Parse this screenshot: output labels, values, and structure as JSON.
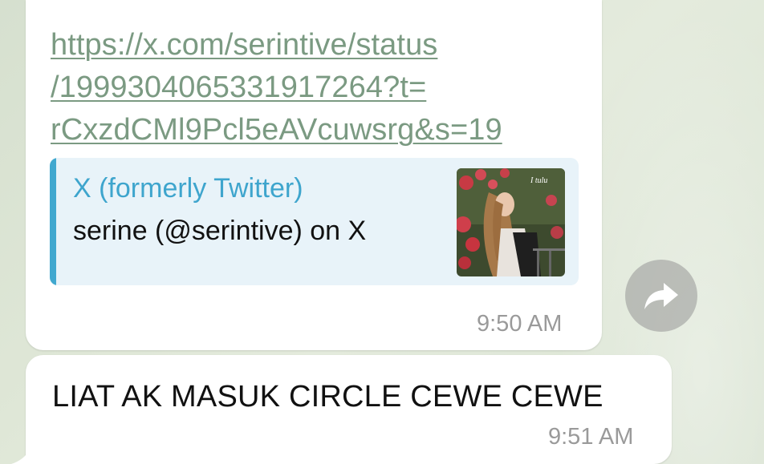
{
  "messages": [
    {
      "link": "https://x.com/serintive/status\n/1999304065331917264?t=\nrCxzdCMl9Pcl5eAVcuwsrg&s=19",
      "preview": {
        "site_name": "X (formerly Twitter)",
        "title": "serine (@serintive) on X",
        "thumbnail_caption": "I tulu"
      },
      "time": "9:50 AM"
    },
    {
      "text": "LIAT AK MASUK CIRCLE CEWE CEWE",
      "time": "9:51 AM"
    }
  ],
  "icons": {
    "forward": "forward-arrow-icon"
  },
  "colors": {
    "link": "#7b9a82",
    "preview_accent": "#41a8cf",
    "preview_background": "#e8f3f9",
    "timestamp": "#9a9a9a"
  }
}
